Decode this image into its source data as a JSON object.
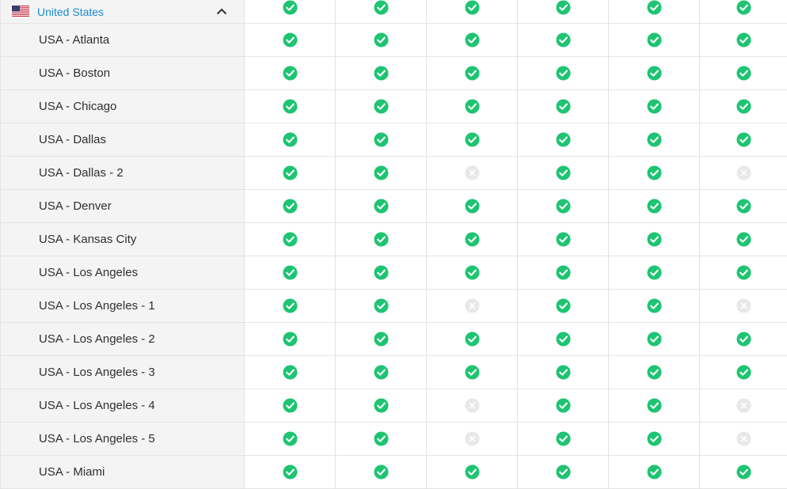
{
  "country": {
    "name": "United States",
    "flag_icon": "us-flag-icon",
    "toggle_icon": "chevron-up-icon",
    "header_status": [
      true,
      true,
      true,
      true,
      true,
      true
    ]
  },
  "colors": {
    "check": "#1ec472",
    "cross": "#e8e8e8",
    "link": "#1a8ad1"
  },
  "rows": [
    {
      "name": "USA - Atlanta",
      "status": [
        true,
        true,
        true,
        true,
        true,
        true
      ]
    },
    {
      "name": "USA - Boston",
      "status": [
        true,
        true,
        true,
        true,
        true,
        true
      ]
    },
    {
      "name": "USA - Chicago",
      "status": [
        true,
        true,
        true,
        true,
        true,
        true
      ]
    },
    {
      "name": "USA - Dallas",
      "status": [
        true,
        true,
        true,
        true,
        true,
        true
      ]
    },
    {
      "name": "USA - Dallas - 2",
      "status": [
        true,
        true,
        false,
        true,
        true,
        false
      ]
    },
    {
      "name": "USA - Denver",
      "status": [
        true,
        true,
        true,
        true,
        true,
        true
      ]
    },
    {
      "name": "USA - Kansas City",
      "status": [
        true,
        true,
        true,
        true,
        true,
        true
      ]
    },
    {
      "name": "USA - Los Angeles",
      "status": [
        true,
        true,
        true,
        true,
        true,
        true
      ]
    },
    {
      "name": "USA - Los Angeles - 1",
      "status": [
        true,
        true,
        false,
        true,
        true,
        false
      ]
    },
    {
      "name": "USA - Los Angeles - 2",
      "status": [
        true,
        true,
        true,
        true,
        true,
        true
      ]
    },
    {
      "name": "USA - Los Angeles - 3",
      "status": [
        true,
        true,
        true,
        true,
        true,
        true
      ]
    },
    {
      "name": "USA - Los Angeles - 4",
      "status": [
        true,
        true,
        false,
        true,
        true,
        false
      ]
    },
    {
      "name": "USA - Los Angeles - 5",
      "status": [
        true,
        true,
        false,
        true,
        true,
        false
      ]
    },
    {
      "name": "USA - Miami",
      "status": [
        true,
        true,
        true,
        true,
        true,
        true
      ]
    }
  ]
}
